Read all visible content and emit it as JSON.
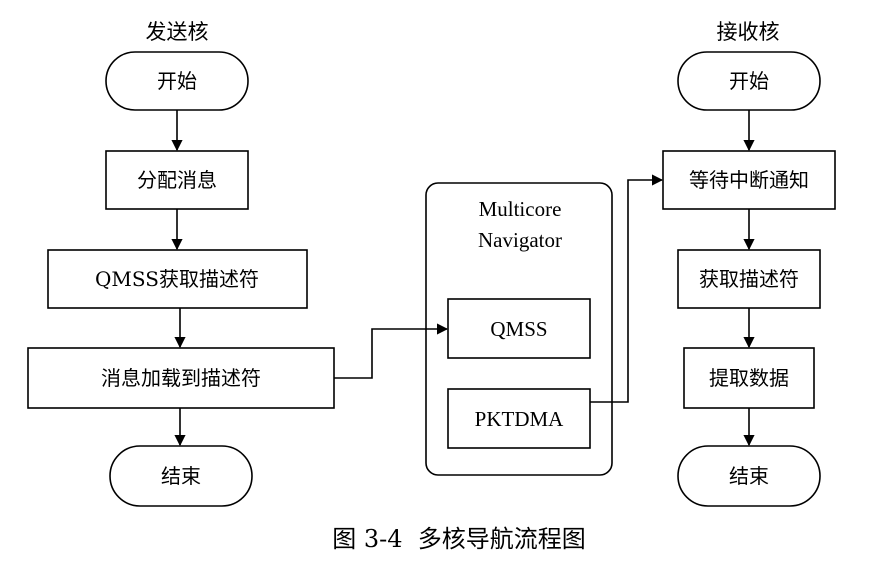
{
  "sender": {
    "heading": "发送核",
    "start": "开始",
    "step1": "分配消息",
    "step2": "QMSS获取描述符",
    "step3": "消息加载到描述符",
    "end": "结束"
  },
  "navigator": {
    "title_line1": "Multicore",
    "title_line2": "Navigator",
    "qmss": "QMSS",
    "pktdma": "PKTDMA"
  },
  "receiver": {
    "heading": "接收核",
    "start": "开始",
    "step1": "等待中断通知",
    "step2": "获取描述符",
    "step3": "提取数据",
    "end": "结束"
  },
  "caption": "图 3-4  多核导航流程图"
}
